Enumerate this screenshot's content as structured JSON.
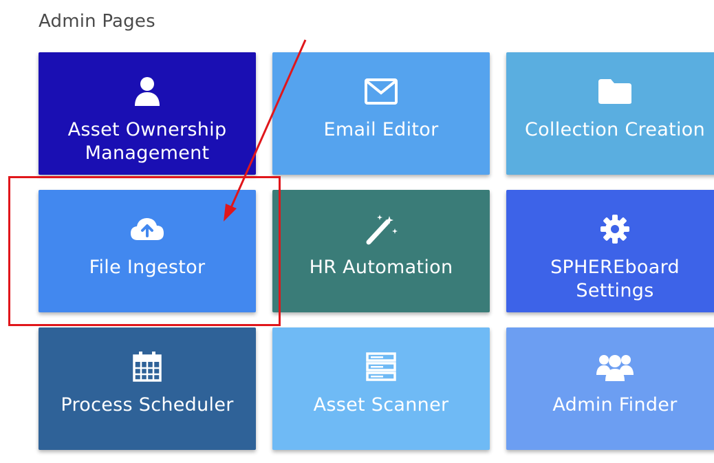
{
  "section": {
    "title": "Admin Pages"
  },
  "colors": {
    "highlight": "#e0161b",
    "arrow": "#e0161b"
  },
  "tiles": [
    {
      "label": "Asset Ownership\nManagement",
      "icon": "user-icon",
      "color": "#1a0fb3"
    },
    {
      "label": "Email Editor",
      "icon": "envelope-icon",
      "color": "#55a3ee"
    },
    {
      "label": "Collection Creation",
      "icon": "folder-icon",
      "color": "#5aaee0"
    },
    {
      "label": "File Ingestor",
      "icon": "cloud-upload-icon",
      "color": "#4288ef"
    },
    {
      "label": "HR Automation",
      "icon": "magic-wand-icon",
      "color": "#3a7c78"
    },
    {
      "label": "SPHEREboard\nSettings",
      "icon": "gear-icon",
      "color": "#3d63e8"
    },
    {
      "label": "Process Scheduler",
      "icon": "calendar-icon",
      "color": "#2f6298"
    },
    {
      "label": "Asset Scanner",
      "icon": "server-icon",
      "color": "#6fbaf5"
    },
    {
      "label": "Admin Finder",
      "icon": "users-icon",
      "color": "#6c9ef2"
    }
  ]
}
